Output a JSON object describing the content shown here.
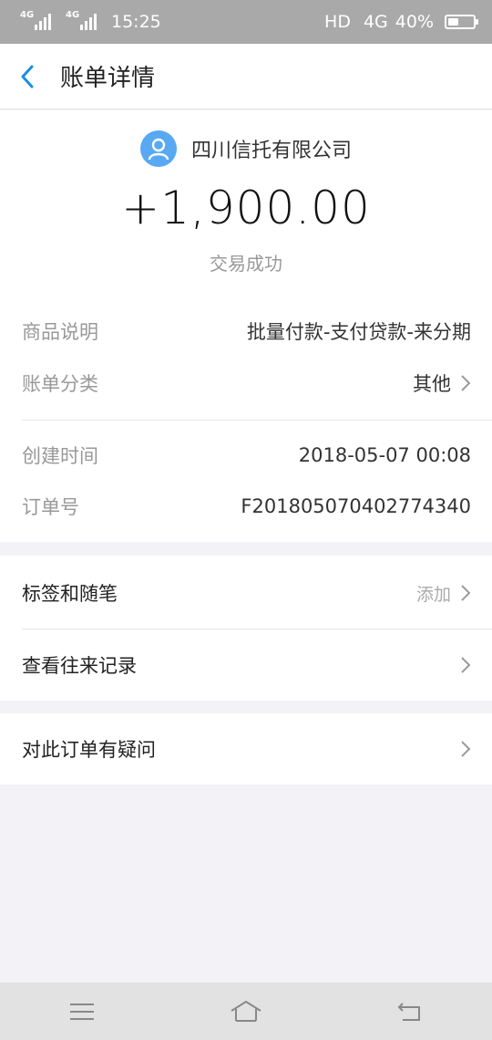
{
  "status_bar": {
    "signal1": "4G",
    "signal2": "4G",
    "time": "15:25",
    "hd": "HD",
    "network": "4G",
    "battery": "40%"
  },
  "header": {
    "title": "账单详情"
  },
  "summary": {
    "payee": "四川信托有限公司",
    "amount": "+1,900.00",
    "status": "交易成功"
  },
  "details": [
    {
      "label": "商品说明",
      "value": "批量付款-支付贷款-来分期"
    },
    {
      "label": "账单分类",
      "value": "其他"
    },
    {
      "label": "创建时间",
      "value": "2018-05-07 00:08"
    },
    {
      "label": "订单号",
      "value": "F201805070402774340"
    }
  ],
  "actions": {
    "tags": {
      "label": "标签和随笔",
      "hint": "添加"
    },
    "history": {
      "label": "查看往来记录"
    },
    "question": {
      "label": "对此订单有疑问"
    }
  },
  "colors": {
    "accent": "#1a8fe3",
    "avatar": "#58a9f2"
  }
}
